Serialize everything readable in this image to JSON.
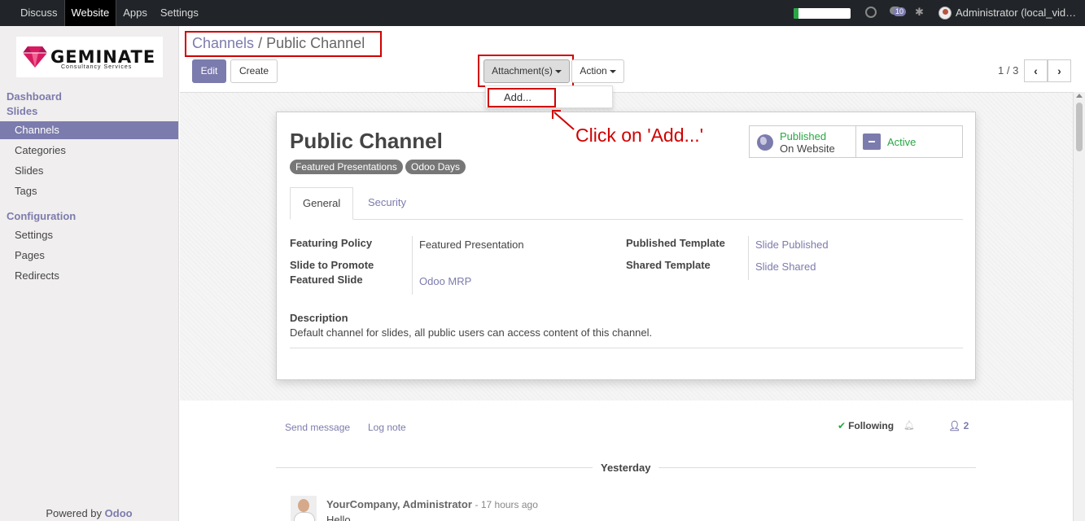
{
  "topbar": {
    "menu": [
      "Discuss",
      "Website",
      "Apps",
      "Settings"
    ],
    "active_menu": "Website",
    "chat_badge": "10",
    "user": "Administrator (local_vid…",
    "progress": 0.08
  },
  "sidebar": {
    "logo_brand": "GEMINATE",
    "logo_tagline": "Consultancy Services",
    "section_dashboard": "Dashboard",
    "section_slides": "Slides",
    "slides_items": [
      "Channels",
      "Categories",
      "Slides",
      "Tags"
    ],
    "section_configuration": "Configuration",
    "config_items": [
      "Settings",
      "Pages",
      "Redirects"
    ],
    "powered_by": "Powered by",
    "powered_brand": "Odoo"
  },
  "control": {
    "breadcrumb_parent": "Channels",
    "breadcrumb_sep": "/",
    "breadcrumb_current": "Public Channel",
    "edit": "Edit",
    "create": "Create",
    "attachments": "Attachment(s)",
    "action": "Action",
    "pager": "1 / 3",
    "dropdown_add": "Add..."
  },
  "annotation": "Click on 'Add...'",
  "record": {
    "title": "Public Channel",
    "tags": [
      "Featured Presentations",
      "Odoo Days"
    ],
    "published_line1": "Published",
    "published_line2": "On Website",
    "active": "Active",
    "tabs": [
      "General",
      "Security"
    ],
    "featuring_policy_label": "Featuring Policy",
    "featuring_policy_value": "Featured Presentation",
    "slide_to_promote_label": "Slide to Promote",
    "featured_slide_label": "Featured Slide",
    "featured_slide_value": "Odoo MRP",
    "published_template_label": "Published Template",
    "published_template_value": "Slide Published",
    "shared_template_label": "Shared Template",
    "shared_template_value": "Slide Shared",
    "description_label": "Description",
    "description_value": "Default channel for slides, all public users can access content of this channel."
  },
  "chatter": {
    "send_message": "Send message",
    "log_note": "Log note",
    "following": "Following",
    "followers_count": "2",
    "day": "Yesterday",
    "author": "YourCompany, Administrator",
    "time": "- 17 hours ago",
    "body": "Hello"
  },
  "colors": {
    "brand": "#7c7bad",
    "highlight": "#d00000",
    "success": "#28a745",
    "topbar": "#212529"
  }
}
